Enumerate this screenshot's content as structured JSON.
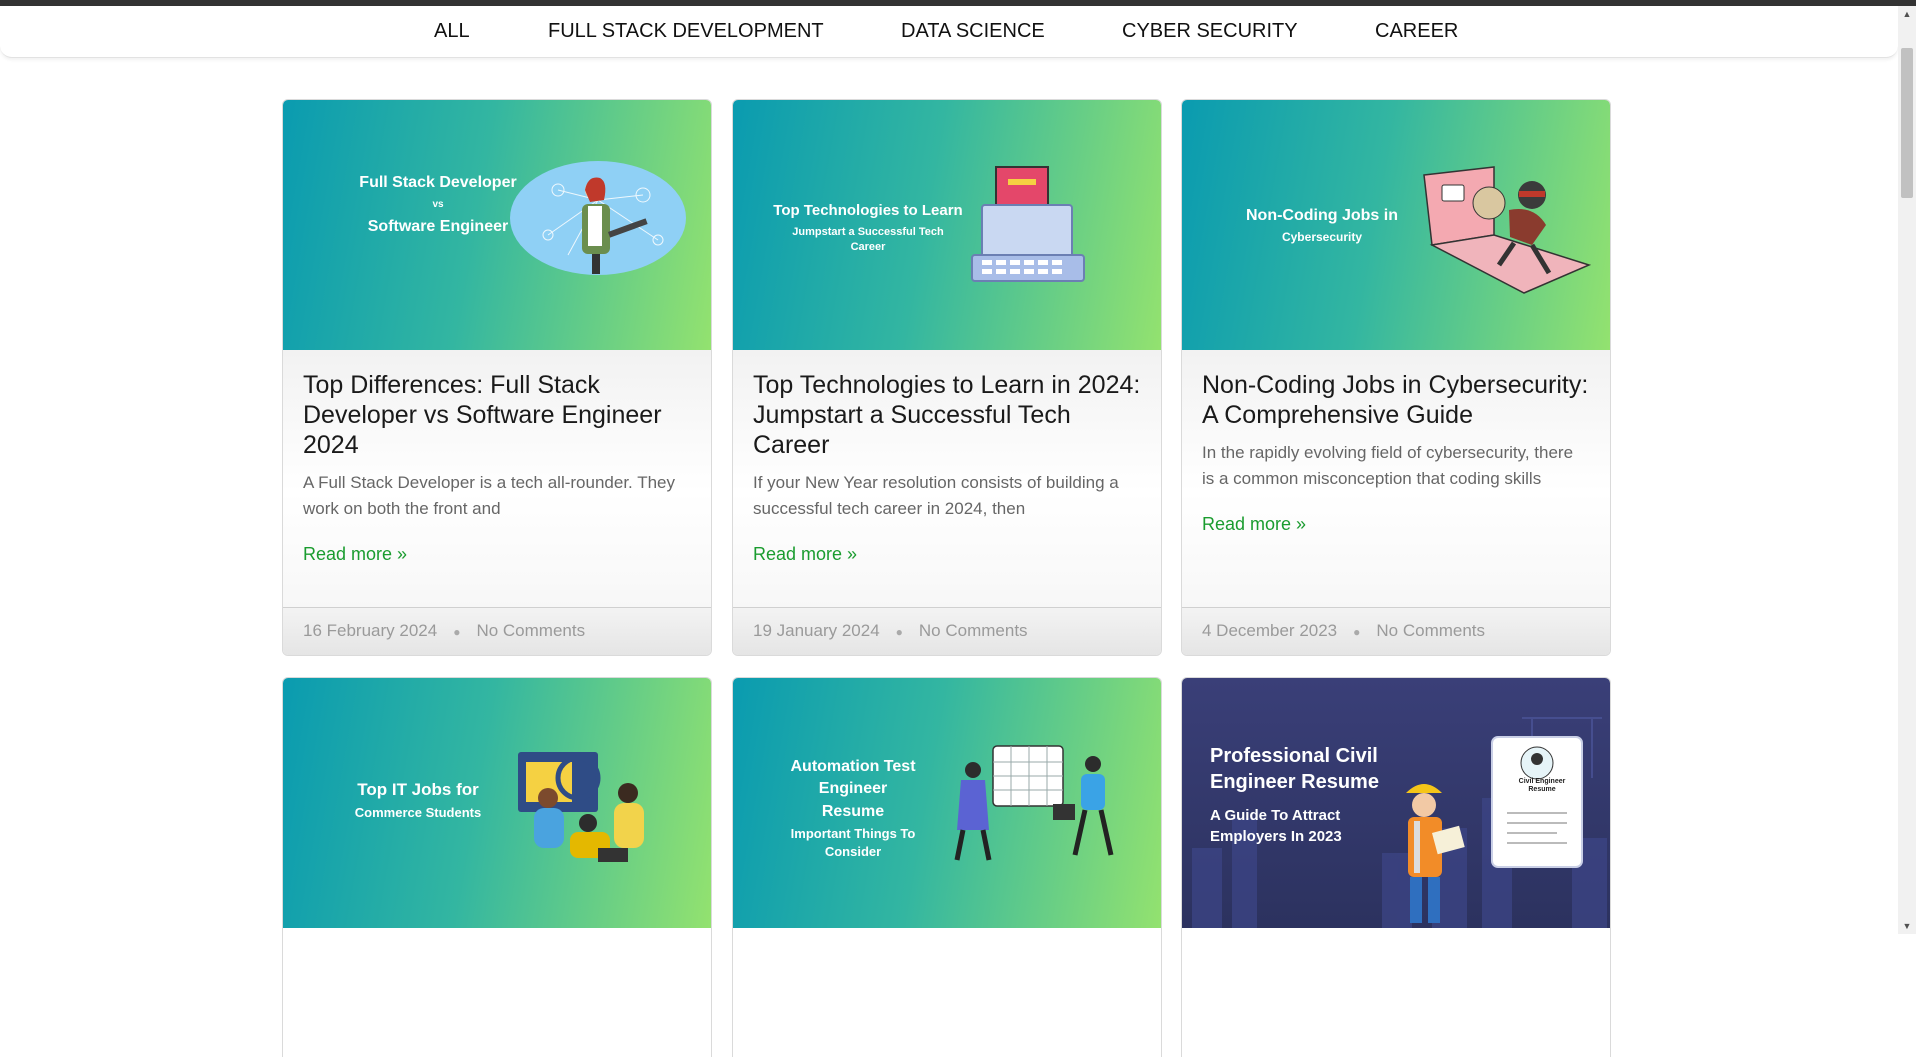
{
  "nav": {
    "items": [
      "ALL",
      "FULL STACK DEVELOPMENT",
      "DATA SCIENCE",
      "CYBER SECURITY",
      "CAREER"
    ]
  },
  "posts": [
    {
      "image_title": "Full Stack Developer",
      "image_mid": "vs",
      "image_sub": "Software Engineer",
      "title": "Top Differences: Full Stack Developer vs Software Engineer 2024",
      "excerpt": "A Full Stack Developer is a tech all-rounder. They work on both the front and",
      "read_more": "Read more »",
      "date": "16 February 2024",
      "comments": "No Comments"
    },
    {
      "image_title": "Top Technologies to Learn",
      "image_sub": "Jumpstart a Successful Tech Career",
      "title": "Top Technologies to Learn in 2024: Jumpstart a Successful Tech Career",
      "excerpt": "If your New Year resolution consists of building a successful tech career in 2024, then",
      "read_more": "Read more »",
      "date": "19 January 2024",
      "comments": "No Comments"
    },
    {
      "image_title": "Non-Coding Jobs in",
      "image_sub": "Cybersecurity",
      "title": "Non-Coding Jobs in Cybersecurity: A Comprehensive Guide",
      "excerpt": "In the rapidly evolving field of cybersecurity, there is a common misconception that coding skills",
      "read_more": "Read more »",
      "date": "4 December 2023",
      "comments": "No Comments"
    },
    {
      "image_title": "Top IT Jobs for",
      "image_sub": "Commerce Students"
    },
    {
      "image_title": "Automation Test Engineer Resume",
      "image_sub": "Important Things To Consider"
    },
    {
      "image_title": "Professional Civil Engineer Resume",
      "image_sub": "A Guide To Attract Employers In 2023",
      "image_doc": "Civil Engineer Resume"
    }
  ],
  "colors": {
    "link": "#1a9c2f",
    "gradient_start": "#0a9bb0",
    "gradient_end": "#93e26f",
    "dark_card": "#2c325f"
  }
}
